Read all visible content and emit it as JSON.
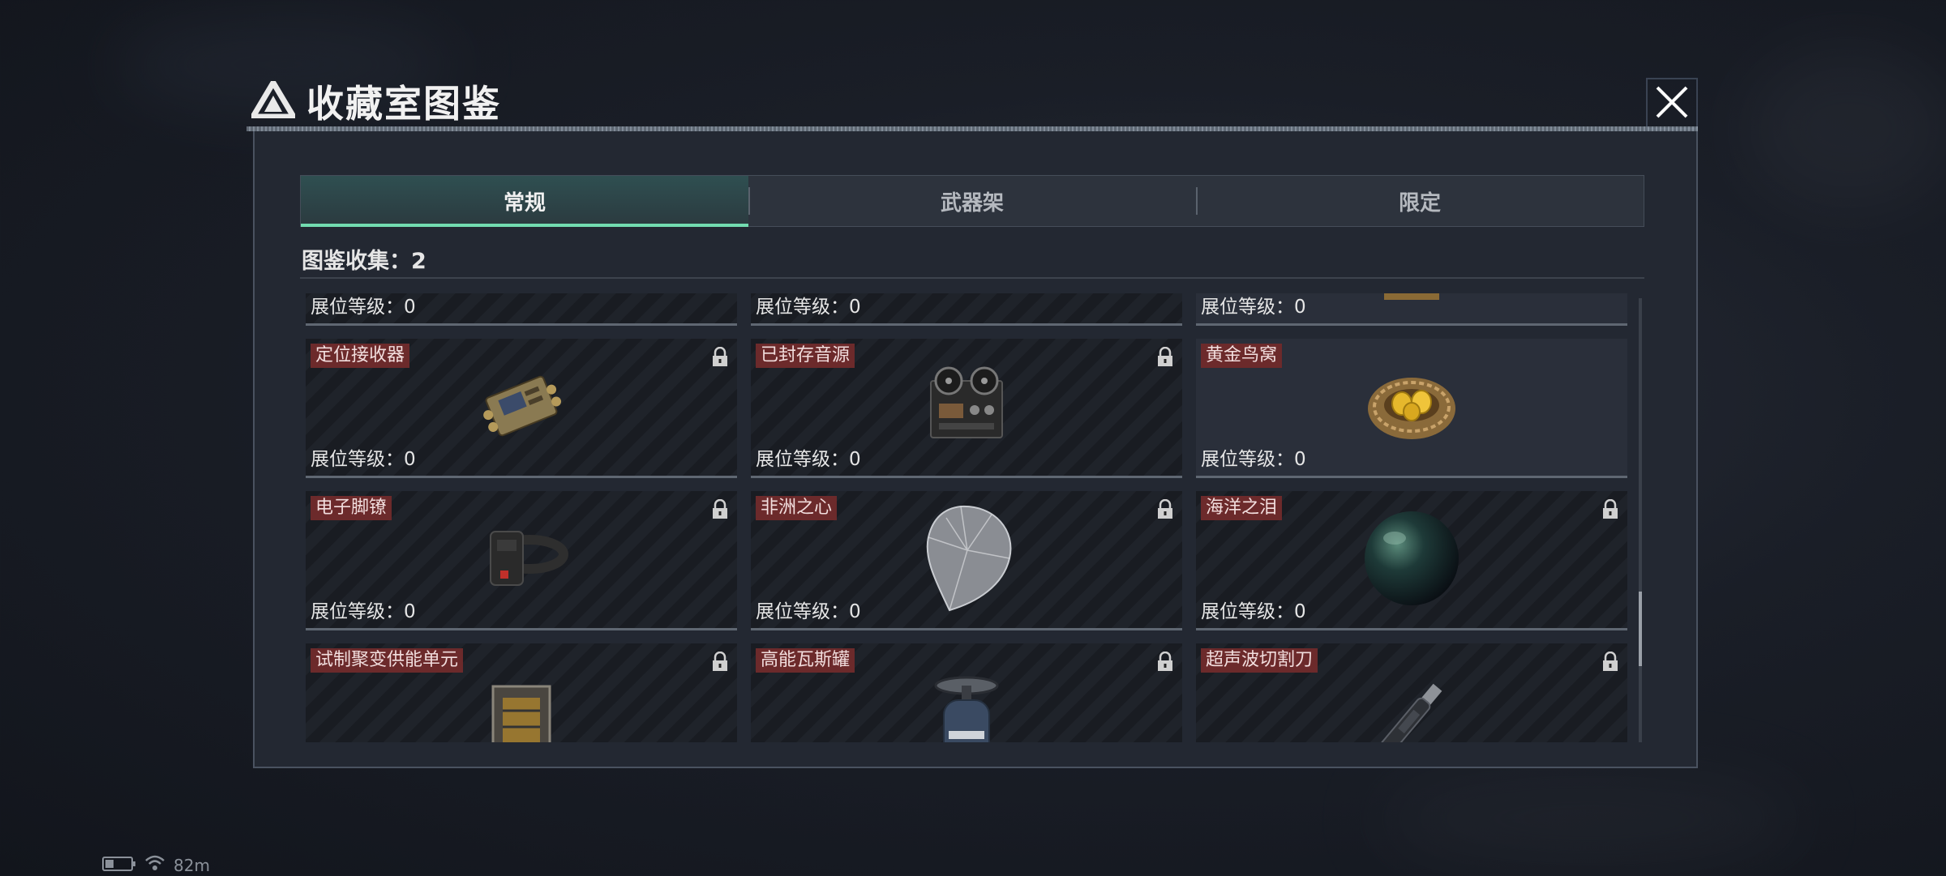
{
  "title": {
    "text": "收藏室图鉴"
  },
  "tabs": [
    {
      "label": "常规",
      "active": true
    },
    {
      "label": "武器架",
      "active": false
    },
    {
      "label": "限定",
      "active": false
    }
  ],
  "collection": {
    "label": "图鉴收集：2"
  },
  "level_label": "展位等级：0",
  "cards": [
    {
      "name": "",
      "level": "展位等级：0",
      "locked": false,
      "icon": "partial-item-icon"
    },
    {
      "name": "",
      "level": "展位等级：0",
      "locked": false,
      "icon": "partial-item-icon"
    },
    {
      "name": "",
      "level": "展位等级：0",
      "locked": false,
      "icon": "partial-item-icon"
    },
    {
      "name": "定位接收器",
      "level": "展位等级：0",
      "locked": true,
      "icon": "receiver-device-icon"
    },
    {
      "name": "已封存音源",
      "level": "展位等级：0",
      "locked": true,
      "icon": "tape-recorder-icon"
    },
    {
      "name": "黄金鸟窝",
      "level": "展位等级：0",
      "locked": false,
      "icon": "golden-nest-icon"
    },
    {
      "name": "电子脚镣",
      "level": "展位等级：0",
      "locked": true,
      "icon": "ankle-monitor-icon"
    },
    {
      "name": "非洲之心",
      "level": "展位等级：0",
      "locked": true,
      "icon": "diamond-icon"
    },
    {
      "name": "海洋之泪",
      "level": "展位等级：0",
      "locked": true,
      "icon": "black-pearl-icon"
    },
    {
      "name": "试制聚变供能单元",
      "level": "",
      "locked": true,
      "icon": "fusion-cell-icon"
    },
    {
      "name": "高能瓦斯罐",
      "level": "",
      "locked": true,
      "icon": "gas-tank-icon"
    },
    {
      "name": "超声波切割刀",
      "level": "",
      "locked": true,
      "icon": "cutter-knife-icon"
    }
  ],
  "status": {
    "signal": "82m"
  },
  "colors": {
    "accent": "#72dcb0",
    "name_badge": "#6c2a2b",
    "panel": "#232832"
  }
}
